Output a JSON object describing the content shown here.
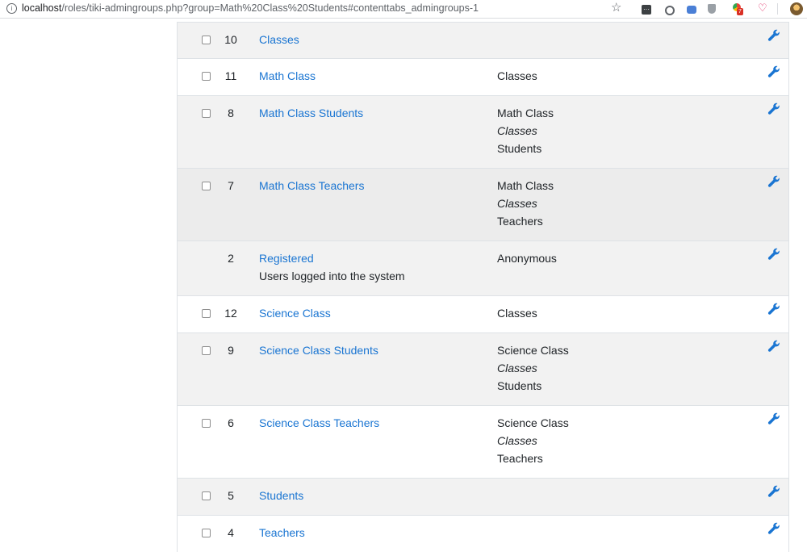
{
  "browser": {
    "url_host": "localhost",
    "url_path": "/roles/tiki-admingroups.php?group=Math%20Class%20Students#contenttabs_admingroups-1",
    "icons": [
      "info-icon",
      "star-icon",
      "extension-icon",
      "circle-icon",
      "translate-icon",
      "shield-icon",
      "chrome-extension-icon",
      "pocket-icon",
      "profile-avatar-icon"
    ],
    "ext_badge": "7"
  },
  "groups": [
    {
      "id": "10",
      "name": "Classes",
      "desc": "",
      "parents": [],
      "checkbox": true
    },
    {
      "id": "11",
      "name": "Math Class",
      "desc": "",
      "parents": [
        {
          "text": "Classes",
          "italic": false
        }
      ],
      "checkbox": true
    },
    {
      "id": "8",
      "name": "Math Class Students",
      "desc": "",
      "parents": [
        {
          "text": "Math Class",
          "italic": false
        },
        {
          "text": "Classes",
          "italic": true
        },
        {
          "text": "Students",
          "italic": false
        }
      ],
      "checkbox": true
    },
    {
      "id": "7",
      "name": "Math Class Teachers",
      "desc": "",
      "parents": [
        {
          "text": "Math Class",
          "italic": false
        },
        {
          "text": "Classes",
          "italic": true
        },
        {
          "text": "Teachers",
          "italic": false
        }
      ],
      "checkbox": true
    },
    {
      "id": "2",
      "name": "Registered",
      "desc": "Users logged into the system",
      "parents": [
        {
          "text": "Anonymous",
          "italic": false
        }
      ],
      "checkbox": false
    },
    {
      "id": "12",
      "name": "Science Class",
      "desc": "",
      "parents": [
        {
          "text": "Classes",
          "italic": false
        }
      ],
      "checkbox": true
    },
    {
      "id": "9",
      "name": "Science Class Students",
      "desc": "",
      "parents": [
        {
          "text": "Science Class",
          "italic": false
        },
        {
          "text": "Classes",
          "italic": true
        },
        {
          "text": "Students",
          "italic": false
        }
      ],
      "checkbox": true
    },
    {
      "id": "6",
      "name": "Science Class Teachers",
      "desc": "",
      "parents": [
        {
          "text": "Science Class",
          "italic": false
        },
        {
          "text": "Classes",
          "italic": true
        },
        {
          "text": "Teachers",
          "italic": false
        }
      ],
      "checkbox": true
    },
    {
      "id": "5",
      "name": "Students",
      "desc": "",
      "parents": [],
      "checkbox": true
    },
    {
      "id": "4",
      "name": "Teachers",
      "desc": "",
      "parents": [],
      "checkbox": true
    }
  ],
  "colors": {
    "link": "#1a75d2",
    "stripe": "#f2f2f2",
    "highlight": "#ececec"
  }
}
